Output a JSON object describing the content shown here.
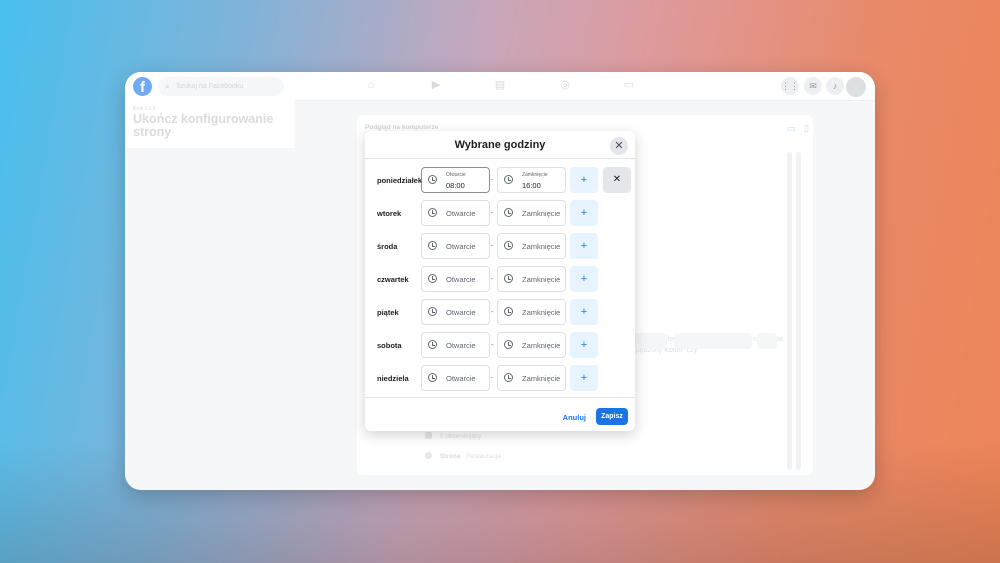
{
  "topbar": {
    "search_placeholder": "Szukaj na Facebooku"
  },
  "left_panel": {
    "step": "Krok 1 z 5",
    "title": "Ukończ konfigurowanie strony"
  },
  "preview": {
    "title": "Podgląd na komputerze",
    "text": "kontroli... w najlepszym tego słowa mówie nazwy jak \"Rozpędzony Kotlet\" czy",
    "followers": "0 obserwujący",
    "page_label": "Strona",
    "page_category": "Restauracja"
  },
  "dialog": {
    "title": "Wybrane godziny",
    "open_placeholder": "Otwarcie",
    "close_placeholder": "Zamknięcie",
    "add_label": "+",
    "remove_label": "✕",
    "cancel_label": "Anuluj",
    "save_label": "Zapisz",
    "days": [
      {
        "name": "poniedziałek",
        "open_label": "Otwarcie",
        "open_value": "08:00",
        "close_label": "Zamknięcie",
        "close_value": "16:00"
      },
      {
        "name": "wtorek"
      },
      {
        "name": "środa"
      },
      {
        "name": "czwartek"
      },
      {
        "name": "piątek"
      },
      {
        "name": "sobota"
      },
      {
        "name": "niedziela"
      }
    ]
  },
  "colors": {
    "primary": "#1877f2",
    "save_button": "#1b74e4",
    "plus_bg": "#e7f3ff"
  },
  "icons": [
    "facebook-logo",
    "search-icon",
    "home-icon",
    "video-icon",
    "marketplace-icon",
    "groups-icon",
    "gaming-icon",
    "menu-grid-icon",
    "messenger-icon",
    "bell-icon",
    "clock-icon",
    "close-icon",
    "plus-icon",
    "desktop-icon",
    "mobile-icon"
  ]
}
